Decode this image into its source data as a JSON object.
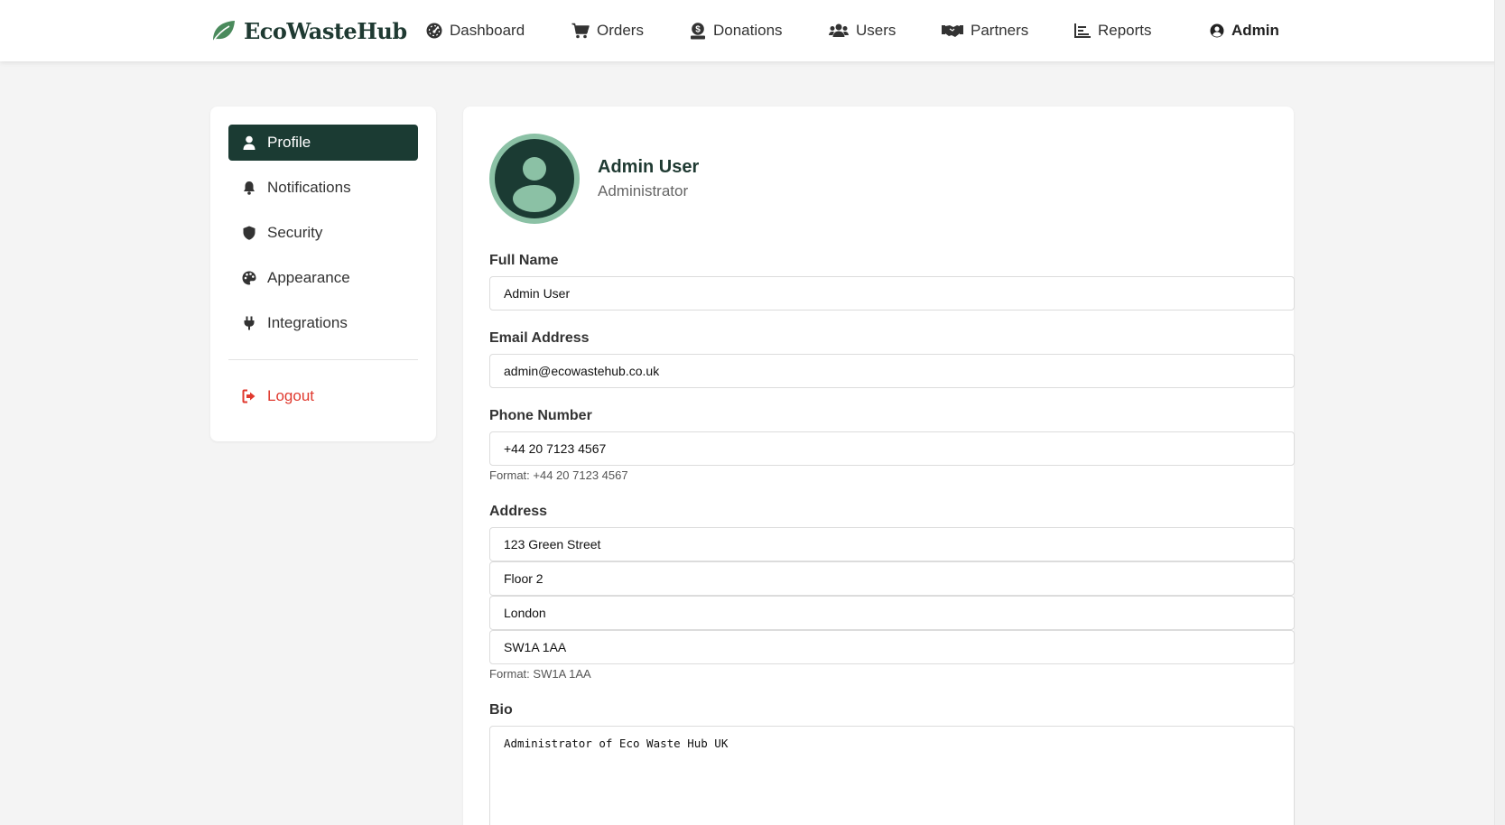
{
  "brand": {
    "name": "EcoWasteHub",
    "color": "#4a8a5c"
  },
  "nav": {
    "items": [
      {
        "label": "Dashboard",
        "icon": "gauge-icon"
      },
      {
        "label": "Orders",
        "icon": "cart-icon"
      },
      {
        "label": "Donations",
        "icon": "donation-icon"
      },
      {
        "label": "Users",
        "icon": "users-icon"
      },
      {
        "label": "Partners",
        "icon": "handshake-icon"
      },
      {
        "label": "Reports",
        "icon": "chart-icon"
      }
    ],
    "account": {
      "label": "Admin",
      "icon": "user-circle-icon"
    }
  },
  "sidebar": {
    "items": [
      {
        "label": "Profile",
        "icon": "user-icon",
        "active": true
      },
      {
        "label": "Notifications",
        "icon": "bell-icon"
      },
      {
        "label": "Security",
        "icon": "shield-icon"
      },
      {
        "label": "Appearance",
        "icon": "palette-icon"
      },
      {
        "label": "Integrations",
        "icon": "plug-icon"
      }
    ],
    "logout": {
      "label": "Logout",
      "icon": "logout-icon",
      "color": "#e03a2f"
    },
    "active_color": "#1b3b33"
  },
  "profile": {
    "name": "Admin User",
    "role": "Administrator",
    "avatar_ring_color": "#8bc1a5",
    "avatar_color": "#1b3b33"
  },
  "form": {
    "full_name": {
      "label": "Full Name",
      "value": "Admin User"
    },
    "email": {
      "label": "Email Address",
      "value": "admin@ecowastehub.co.uk"
    },
    "phone": {
      "label": "Phone Number",
      "value": "+44 20 7123 4567",
      "hint": "Format: +44 20 7123 4567"
    },
    "address": {
      "label": "Address",
      "line1": "123 Green Street",
      "line2": "Floor 2",
      "city": "London",
      "postcode": "SW1A 1AA",
      "hint": "Format: SW1A 1AA"
    },
    "bio": {
      "label": "Bio",
      "value": "Administrator of Eco Waste Hub UK"
    }
  }
}
